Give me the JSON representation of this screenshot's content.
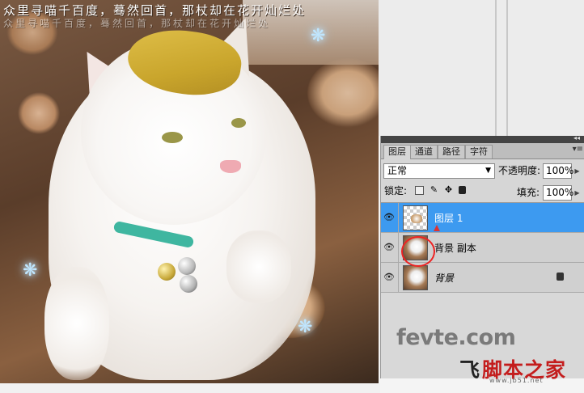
{
  "image_overlay": {
    "caption": "众里寻喵千百度，蓦然回首，那杖却在花开灿烂处",
    "caption_shadow": "众里寻喵千百度，蓦然回首，那杖却在花开灿烂处"
  },
  "layers_panel": {
    "tabs": [
      {
        "label": "图层",
        "active": true
      },
      {
        "label": "通道",
        "active": false
      },
      {
        "label": "路径",
        "active": false
      },
      {
        "label": "字符",
        "active": false
      }
    ],
    "blend_mode": "正常",
    "opacity_label": "不透明度:",
    "opacity_value": "100%",
    "lock_label": "锁定:",
    "fill_label": "填充:",
    "fill_value": "100%",
    "layers": [
      {
        "name": "图层 1",
        "selected": true,
        "thumbnail": "transparent-with-photo"
      },
      {
        "name": "背景 副本",
        "selected": false,
        "thumbnail": "photo"
      },
      {
        "name": "背景",
        "selected": false,
        "thumbnail": "photo",
        "locked": true
      }
    ],
    "icons": [
      "eye-icon",
      "lock-icon",
      "collapse-icon",
      "panel-menu-icon"
    ]
  },
  "watermark": {
    "site": "fevte.com",
    "logo_k": "飞",
    "logo_text": "脚本之家",
    "logo_url": "www.jb51.net"
  },
  "colors": {
    "selected_layer": "#3d9af0",
    "highlight_circle": "#e22222",
    "logo_red": "#c41d1d"
  }
}
